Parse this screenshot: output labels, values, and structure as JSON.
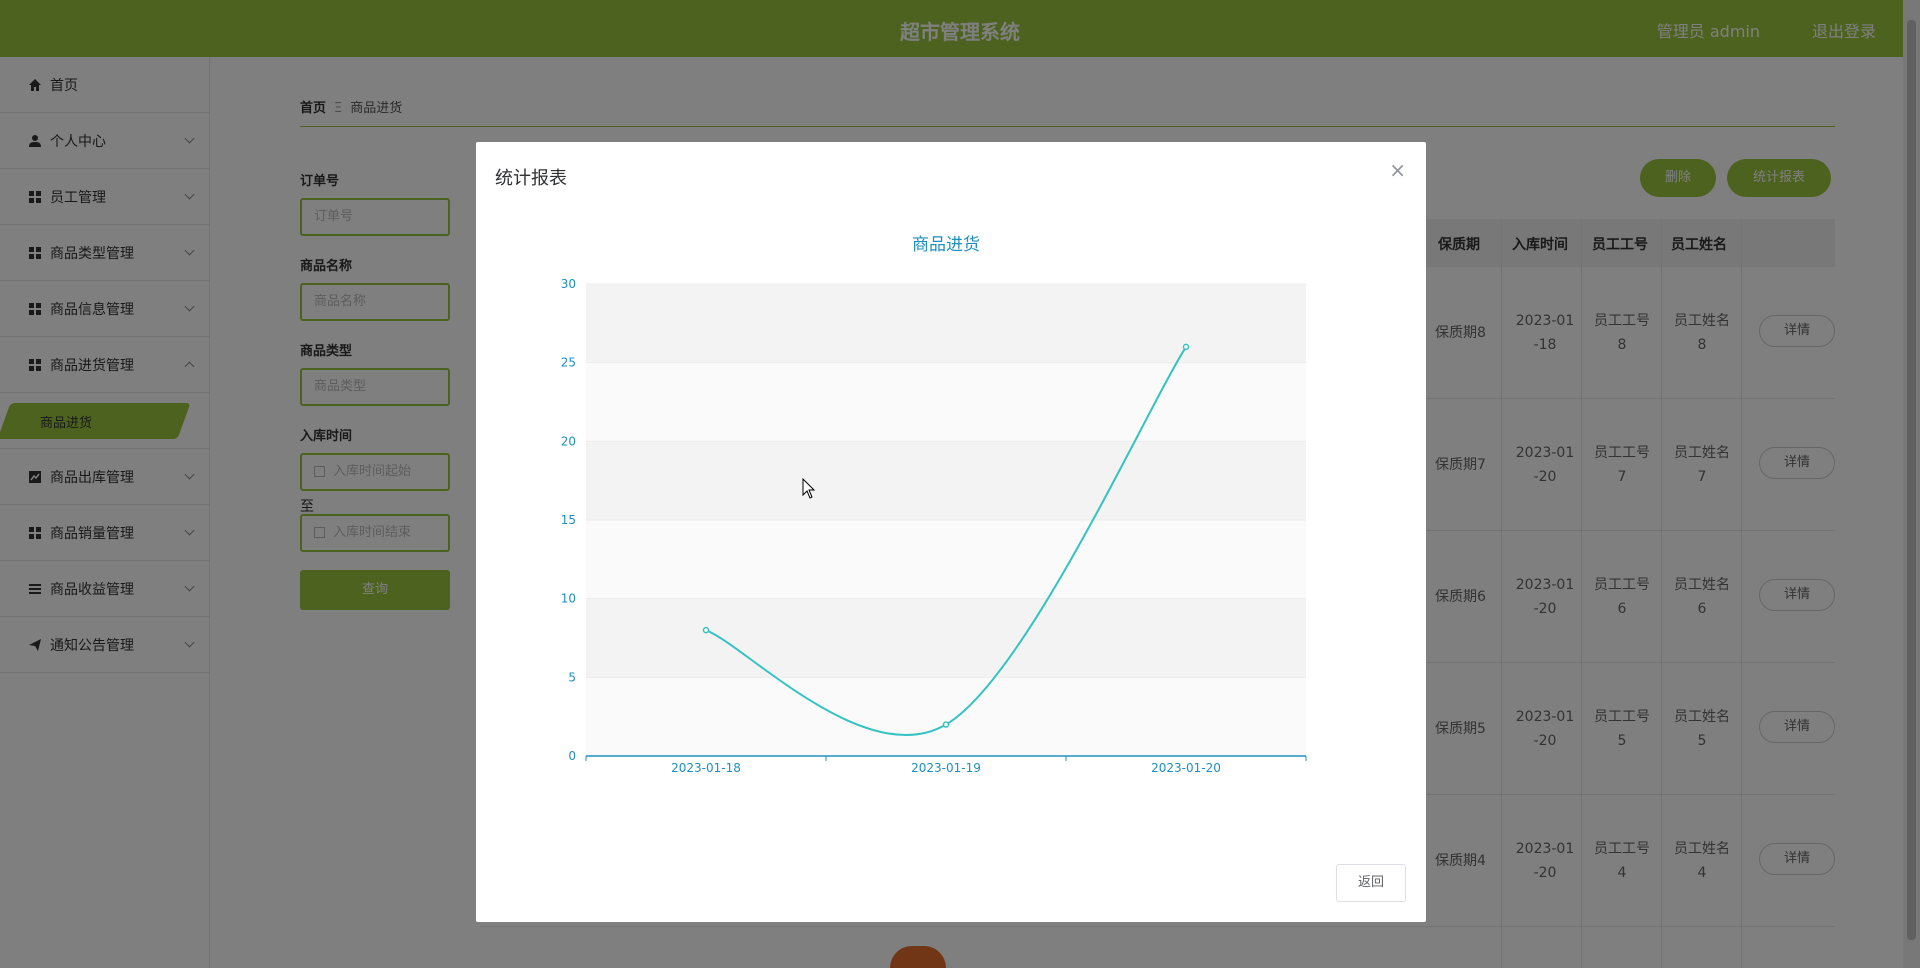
{
  "header": {
    "title": "超市管理系统",
    "user": "管理员 admin",
    "logout": "退出登录"
  },
  "sidebar": {
    "items": [
      {
        "label": "首页",
        "icon": "home-icon"
      },
      {
        "label": "个人中心",
        "icon": "user-icon"
      },
      {
        "label": "员工管理",
        "icon": "grid-icon"
      },
      {
        "label": "商品类型管理",
        "icon": "grid-icon"
      },
      {
        "label": "商品信息管理",
        "icon": "grid-icon"
      },
      {
        "label": "商品进货管理",
        "icon": "grid-icon",
        "expanded": true
      },
      {
        "label": "商品出库管理",
        "icon": "chart-icon"
      },
      {
        "label": "商品销量管理",
        "icon": "grid-icon"
      },
      {
        "label": "商品收益管理",
        "icon": "list-icon"
      },
      {
        "label": "通知公告管理",
        "icon": "send-icon"
      }
    ],
    "sub_item": "商品进货"
  },
  "breadcrumb": {
    "home": "首页",
    "separator": "Ξ",
    "current": "商品进货"
  },
  "search": {
    "order_label": "订单号",
    "order_placeholder": "订单号",
    "name_label": "商品名称",
    "name_placeholder": "商品名称",
    "type_label": "商品类型",
    "type_placeholder": "商品类型",
    "time_label": "入库时间",
    "time_start_placeholder": "入库时间起始",
    "to_label": "至",
    "time_end_placeholder": "入库时间结束",
    "query_button": "查询"
  },
  "actions": {
    "delete": "删除",
    "stats": "统计报表"
  },
  "table": {
    "headers": [
      "保质期",
      "入库时间",
      "员工工号",
      "员工姓名"
    ],
    "rows": [
      {
        "shelf": "保质期8",
        "date1": "2023-01",
        "date2": "-18",
        "emp_no1": "员工工号",
        "emp_no2": "8",
        "emp_name1": "员工姓名",
        "emp_name2": "8",
        "detail": "详情"
      },
      {
        "shelf": "保质期7",
        "date1": "2023-01",
        "date2": "-20",
        "emp_no1": "员工工号",
        "emp_no2": "7",
        "emp_name1": "员工姓名",
        "emp_name2": "7",
        "detail": "详情"
      },
      {
        "shelf": "保质期6",
        "date1": "2023-01",
        "date2": "-20",
        "emp_no1": "员工工号",
        "emp_no2": "6",
        "emp_name1": "员工姓名",
        "emp_name2": "6",
        "detail": "详情"
      },
      {
        "shelf": "保质期5",
        "date1": "2023-01",
        "date2": "-20",
        "emp_no1": "员工工号",
        "emp_no2": "5",
        "emp_name1": "员工姓名",
        "emp_name2": "5",
        "detail": "详情"
      },
      {
        "shelf": "保质期4",
        "date1": "2023-01",
        "date2": "-20",
        "emp_no1": "员工工号",
        "emp_no2": "4",
        "emp_name1": "员工姓名",
        "emp_name2": "4",
        "detail": "详情"
      }
    ]
  },
  "modal": {
    "title": "统计报表",
    "close": "×",
    "back_button": "返回"
  },
  "chart_data": {
    "type": "line",
    "title": "商品进货",
    "categories": [
      "2023-01-18",
      "2023-01-19",
      "2023-01-20"
    ],
    "values": [
      8,
      2,
      26
    ],
    "ylim": [
      0,
      30
    ],
    "yticks": [
      0,
      5,
      10,
      15,
      20,
      25,
      30
    ],
    "smooth": true,
    "grid": "horizontal bands",
    "colors": {
      "line": "#37c2c2",
      "axis": "#1f8fbf",
      "title": "#1f8fbf"
    }
  }
}
